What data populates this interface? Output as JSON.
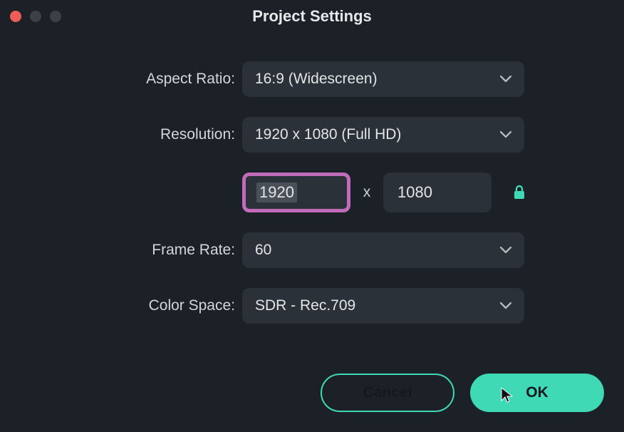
{
  "window": {
    "title": "Project Settings"
  },
  "labels": {
    "aspect_ratio": "Aspect Ratio:",
    "resolution": "Resolution:",
    "frame_rate": "Frame Rate:",
    "color_space": "Color Space:"
  },
  "values": {
    "aspect_ratio": "16:9 (Widescreen)",
    "resolution_preset": "1920 x 1080 (Full HD)",
    "width": "1920",
    "separator": "x",
    "height": "1080",
    "frame_rate": "60",
    "color_space": "SDR - Rec.709"
  },
  "buttons": {
    "cancel": "Cancel",
    "ok": "OK"
  }
}
